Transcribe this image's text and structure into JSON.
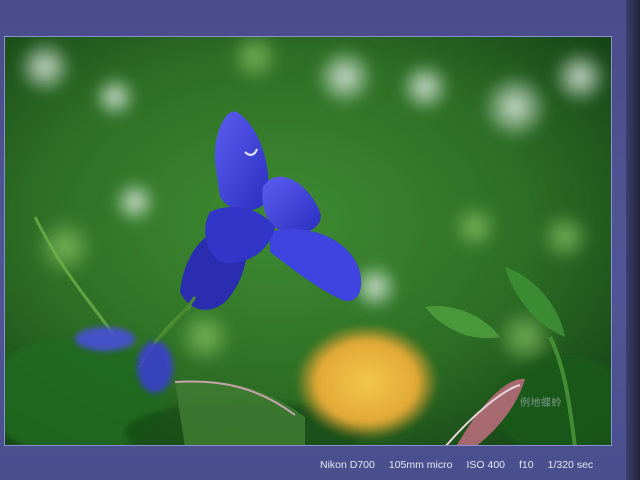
{
  "photo": {
    "subject": "blue-flower-photo",
    "watermark": "例地蝶蛉"
  },
  "exif": {
    "camera": "Nikon D700",
    "lens": "105mm micro",
    "iso": "ISO 400",
    "aperture": "f10",
    "shutter": "1/320 sec"
  },
  "colors": {
    "frame_bg": "#4f5596",
    "flower_blue": "#3a3fd8",
    "bokeh_yellow": "#e7b43a",
    "foliage_green": "#2f8a2c"
  }
}
